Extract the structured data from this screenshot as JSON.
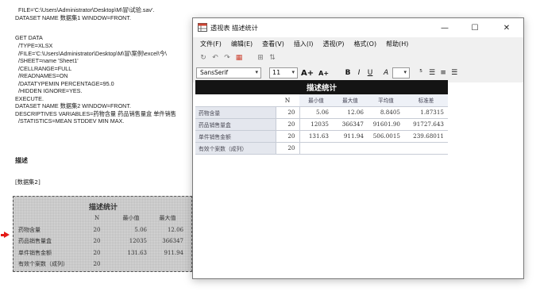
{
  "viewer": {
    "syntax_lines": [
      "  FILE='C:\\Users\\Administrator\\Desktop\\M\\冒\\试验.sav'.",
      "DATASET NAME 数据集1 WINDOW=FRONT.",
      "",
      "GET DATA",
      "  /TYPE=XLSX",
      "  /FILE='C:\\Users\\Administrator\\Desktop\\M\\冒\\案例\\excel\\今\\",
      "  /SHEET=name 'Sheet1'",
      "  /CELLRANGE=FULL",
      "  /READNAMES=ON",
      "  /DATATYPEMIN PERCENTAGE=95.0",
      "  /HIDDEN IGNORE=YES.",
      "EXECUTE.",
      "DATASET NAME 数据集2 WINDOW=FRONT.",
      "DESCRIPTIVES VARIABLES=药物含量 药品销售量盒 单件销售",
      "  /STATISTICS=MEAN STDDEV MIN MAX."
    ],
    "section_heading": "描述",
    "dataset_label": "[数据集2]",
    "table": {
      "title": "描述统计",
      "columns": [
        "N",
        "最小值",
        "最大值"
      ],
      "rows": [
        {
          "label": "药物含量",
          "n": "20",
          "min": "5.06",
          "max": "12.06"
        },
        {
          "label": "药品销售量盒",
          "n": "20",
          "min": "12035",
          "max": "366347"
        },
        {
          "label": "单件销售金额",
          "n": "20",
          "min": "131.63",
          "max": "911.94"
        },
        {
          "label": "有效个案数（成列）",
          "n": "20",
          "min": "",
          "max": ""
        }
      ]
    }
  },
  "window": {
    "title": "透视表 描述统计",
    "minimize": "—",
    "maximize": "☐",
    "close": "✕",
    "menu": [
      "文件(F)",
      "编辑(E)",
      "查看(V)",
      "插入(I)",
      "透视(P)",
      "格式(O)",
      "帮助(H)"
    ],
    "font_name": "SansSerif",
    "font_size": "11",
    "format_buttons": {
      "grow_font": "A+",
      "shrink_font": "A+",
      "bold": "B",
      "italic": "I",
      "underline": "U",
      "color": "A"
    }
  },
  "pivot": {
    "title": "描述统计",
    "columns": [
      "N",
      "最小值",
      "最大值",
      "平均值",
      "标准差"
    ],
    "rows": [
      {
        "label": "药物含量",
        "values": [
          "20",
          "5.06",
          "12.06",
          "8.8405",
          "1.87315"
        ]
      },
      {
        "label": "药品销售量盒",
        "values": [
          "20",
          "12035",
          "366347",
          "91601.90",
          "91727.643"
        ]
      },
      {
        "label": "单件销售金额",
        "values": [
          "20",
          "131.63",
          "911.94",
          "506.0015",
          "239.68011"
        ]
      },
      {
        "label": "有效个案数（成列）",
        "values": [
          "20",
          "",
          "",
          "",
          ""
        ]
      }
    ]
  }
}
